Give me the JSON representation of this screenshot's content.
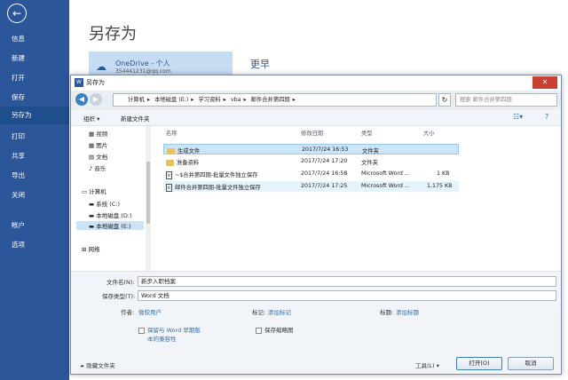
{
  "sidebar": {
    "items": [
      "信息",
      "新建",
      "打开",
      "保存",
      "另存为",
      "打印",
      "共享",
      "导出",
      "关闭",
      "帐户",
      "选项"
    ],
    "active": "另存为"
  },
  "backstage": {
    "title": "另存为",
    "onedrive": {
      "name": "OneDrive - 个人",
      "email": "354441231@qq.com"
    },
    "recent_title": "更早"
  },
  "dialog": {
    "title": "另存为",
    "close": "✕",
    "address": [
      "计算机",
      "本地磁盘 (E:)",
      "学习资料",
      "vba",
      "邮件合并第四期"
    ],
    "search_placeholder": "搜索 邮件合并第四期",
    "toolbar": {
      "organize": "组织 ▾",
      "new_folder": "新建文件夹"
    },
    "tree": [
      {
        "label": "视频",
        "icon": "video-icon"
      },
      {
        "label": "图片",
        "icon": "picture-icon"
      },
      {
        "label": "文档",
        "icon": "document-icon"
      },
      {
        "label": "音乐",
        "icon": "music-icon"
      },
      {
        "label": "计算机",
        "icon": "computer-icon"
      },
      {
        "label": "系统 (C:)",
        "icon": "drive-icon"
      },
      {
        "label": "本地磁盘 (D:)",
        "icon": "drive-icon"
      },
      {
        "label": "本地磁盘 (E:)",
        "icon": "drive-icon"
      },
      {
        "label": "网络",
        "icon": "network-icon"
      }
    ],
    "columns": [
      "名称",
      "修改日期",
      "类型",
      "大小"
    ],
    "files": [
      {
        "name": "生成文件",
        "date": "2017/7/24 16:53",
        "type": "文件夹",
        "size": "",
        "kind": "folder"
      },
      {
        "name": "准备资料",
        "date": "2017/7/24 17:20",
        "type": "文件夹",
        "size": "",
        "kind": "folder"
      },
      {
        "name": "~$合并第四期-批量文件独立保存",
        "date": "2017/7/24 16:58",
        "type": "Microsoft Word ...",
        "size": "1 KB",
        "kind": "doc"
      },
      {
        "name": "邮件合并第四期-批量文件独立保存",
        "date": "2017/7/24 17:25",
        "type": "Microsoft Word ...",
        "size": "1,175 KB",
        "kind": "doc"
      }
    ],
    "form": {
      "filename_label": "文件名(N):",
      "filename_value": "新步入职档案",
      "type_label": "保存类型(T):",
      "type_value": "Word 文档",
      "author_label": "作者:",
      "author_value": "微软用户",
      "tags_label": "标记:",
      "tags_value": "添加标记",
      "title_label": "标题:",
      "title_value": "添加标题",
      "compat_line1": "保留与 Word 早期版",
      "compat_line2": "本的兼容性",
      "thumb_label": "保存缩略图"
    },
    "footer": {
      "hide": "隐藏文件夹",
      "tools": "工具(L)",
      "open": "打开(O)",
      "cancel": "取消"
    }
  },
  "colors": {
    "word_blue": "#2b579a",
    "selection": "#cce4f7"
  }
}
